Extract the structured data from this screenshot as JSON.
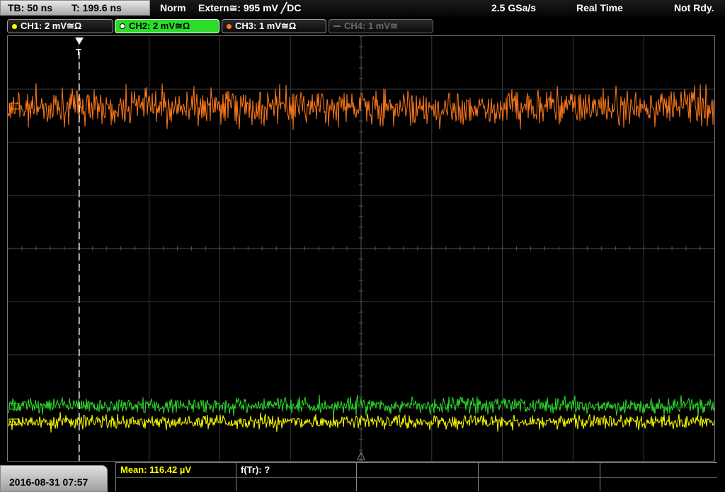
{
  "status_bar": {
    "timebase": "TB: 50 ns",
    "trigger_time": "T: 199.6 ns",
    "trigger_mode": "Norm",
    "trigger_source": "Extern≅: 995 mV ╱DC",
    "sample_rate": "2.5 GSa/s",
    "acq_mode": "Real Time",
    "state": "Not Rdy."
  },
  "channels": [
    {
      "label": "CH1: 2 mV≅Ω",
      "color": "#ffff00",
      "state": "on"
    },
    {
      "label": "CH2: 2 mV≅Ω",
      "color": "#2bdc2b",
      "state": "active"
    },
    {
      "label": "CH3: 1 mV≅Ω",
      "color": "#ff7a1a",
      "state": "on"
    },
    {
      "label": "CH4: 1 mV≅",
      "color": "#6a6a6a",
      "state": "off"
    }
  ],
  "trigger_marker": "T",
  "traces_colors": {
    "ch1": "#ffff00",
    "ch2": "#2bdc2b",
    "ch3": "#ff7a1a"
  },
  "bottom": {
    "datetime": "2016-08-31 07:57",
    "measurements": [
      {
        "label": "Mean: 116.42 µV",
        "color": "#ffff00"
      },
      {
        "label": "f(Tr): ?",
        "color": "#ffffff"
      }
    ]
  }
}
